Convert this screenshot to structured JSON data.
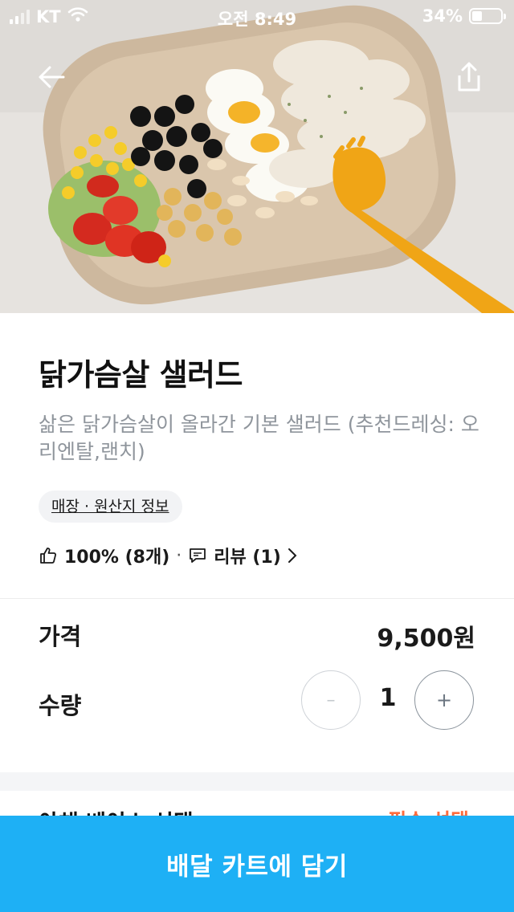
{
  "status_bar": {
    "carrier": "KT",
    "time": "오전 8:49",
    "battery": "34%",
    "battery_level": 0.34
  },
  "header": {
    "back_icon": "arrow-left-icon",
    "share_icon": "share-icon"
  },
  "product": {
    "name": "닭가슴살 샐러드",
    "description": "삶은 닭가슴살이 올라간 기본 샐러드 (추천드레싱: 오리엔탈,랜치)",
    "info_chip": "매장 · 원산지 정보",
    "like_rate": "100% (8개)",
    "separator": "·",
    "review_label": "리뷰 (1)"
  },
  "order": {
    "price_label": "가격",
    "price": "9,500원",
    "quantity_label": "수량",
    "quantity": "1",
    "minus": "–",
    "plus": "+"
  },
  "options": {
    "base_title": "야채 베이스 선택",
    "required": "필수 선택"
  },
  "cta": {
    "label": "배달 카트에 담기",
    "color": "#1eb0f5"
  },
  "colors": {
    "required_accent": "#ff6b3d"
  }
}
